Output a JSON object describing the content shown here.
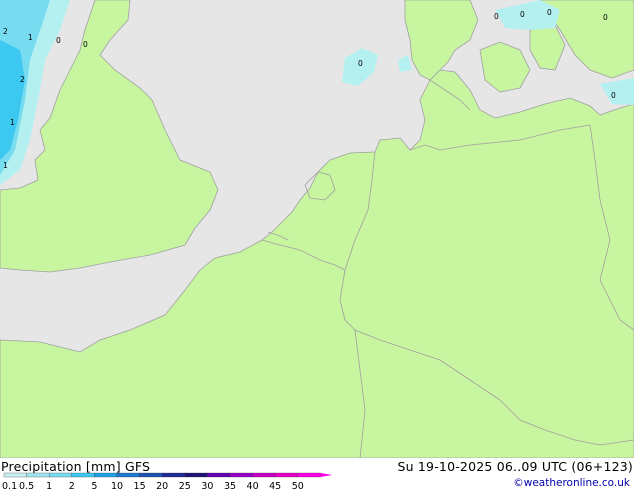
{
  "header": {
    "title_left": "Precipitation [mm] GFS",
    "title_right": "Su 19-10-2025 06..09 UTC (06+123)"
  },
  "credit": "©weatheronline.co.uk",
  "colors": {
    "sea": "#e6e6e6",
    "land": "#c8f5a0",
    "border": "#a0a0a0",
    "coast": "#a0a0a0",
    "precip_light": "#b4f0f0",
    "precip_mid": "#78dcf0",
    "precip_heavy": "#3cc8f0"
  },
  "legend": {
    "labels": [
      "0.1",
      "0.5",
      "1",
      "2",
      "5",
      "10",
      "15",
      "20",
      "25",
      "30",
      "35",
      "40",
      "45",
      "50"
    ],
    "colors": [
      "#c8f0f0",
      "#a0e6f0",
      "#78dcf0",
      "#3cc8f0",
      "#1ea0e6",
      "#1e78d2",
      "#1e50b4",
      "#1e2896",
      "#1e1478",
      "#6400b4",
      "#9600c8",
      "#c800c8",
      "#e600c8",
      "#ff00e6"
    ]
  },
  "point_values": [
    "2",
    "1",
    "0",
    "0",
    "2",
    "1",
    "1",
    "0",
    "0",
    "0",
    "0",
    "0",
    "0"
  ]
}
